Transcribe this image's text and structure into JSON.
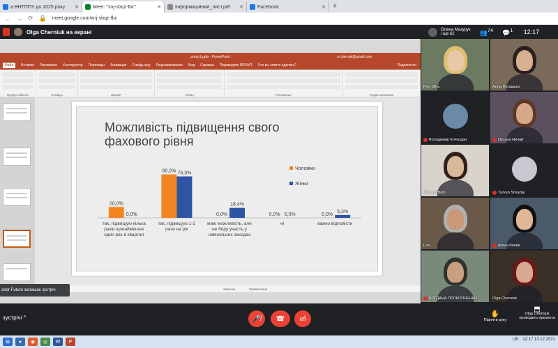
{
  "browser": {
    "tabs": [
      {
        "title": "а ВНТППУ до 2025 року",
        "color": "#1a73e8",
        "active": false
      },
      {
        "title": "Meet: \"xnj-sbqz-fbc\"",
        "color": "#00832d",
        "active": true
      },
      {
        "title": "Інформаційний_лист.pdf",
        "color": "#888888",
        "active": false
      },
      {
        "title": "Facebook",
        "color": "#1877f2",
        "active": false
      }
    ],
    "url": "meet.google.com/xnj-sbqz-fbc"
  },
  "meet": {
    "presenter_label": "Olga Cherniuk на екрані",
    "user_name": "Олена Мазурук",
    "user_sub": "і ще 62",
    "participant_count": "74",
    "chat_count": "1",
    "clock": "12:17",
    "toast": "andr Future залишає зустріч",
    "meeting_details": "зустрічі",
    "raise_hand": "Підняти руку",
    "presenting_line1": "Olga Cherniuk",
    "presenting_line2": "проводить презента"
  },
  "powerpoint": {
    "doc_title": "prezo1.pptx - PowerPoint",
    "account": "o.chernuk@gmail.com",
    "menu": [
      "Файл",
      "Вставка",
      "Рисование",
      "Конструктор",
      "Переходы",
      "Анимация",
      "Слайд-шоу",
      "Рецензирование",
      "Вид",
      "Справка",
      "Переводчик PROMT",
      "Что вы хотите сделать?"
    ],
    "share": "Поделиться",
    "ribbon_groups": [
      "Буфер обмена",
      "Слайды",
      "Шрифт",
      "Абзац",
      "Рисование",
      "Редактирование"
    ],
    "status_items": [
      "Заметки",
      "Примечания"
    ]
  },
  "chart_data": {
    "type": "bar",
    "title": "Можливість підвищення свого фахового рівня",
    "categories": [
      "так, підвищую кілька разів щонайменше один раз в квартал",
      "так, підвищую 1-2 рази на рік",
      "маю можливість, але не беру участь у навчальних заходах",
      "ні",
      "важко відповісти"
    ],
    "series": [
      {
        "name": "Чоловіки",
        "color": "#f4841f",
        "values": [
          20.0,
          80.0,
          0.0,
          0.0,
          0.0
        ],
        "labels": [
          "20,0%",
          "80,0%",
          "0,0%",
          "0,0%",
          "0,0%"
        ]
      },
      {
        "name": "Жінки",
        "color": "#2e55a4",
        "values": [
          0.0,
          76.3,
          18.4,
          0.0,
          5.3
        ],
        "labels": [
          "0,0%",
          "76,3%",
          "18,4%",
          "0,0%",
          "5,3%"
        ]
      }
    ],
    "ylim": [
      0,
      100
    ],
    "legend": "right"
  },
  "participants": [
    {
      "name": "Prof Olha",
      "muted": false,
      "kind": "person",
      "bg": "#6b7a60",
      "skin": "#e7c9a8",
      "hair": "#e0c070"
    },
    {
      "name": "Алла Погашько",
      "muted": false,
      "kind": "person",
      "bg": "#7a6a5a",
      "skin": "#d6b090",
      "hair": "#2a2020"
    },
    {
      "name": "Володимир Кочкодан",
      "muted": true,
      "kind": "avatar",
      "bg": "#202124",
      "av": "#6a8aa8"
    },
    {
      "name": "Оксана Ничай",
      "muted": true,
      "kind": "person",
      "bg": "#5a5060",
      "skin": "#d4a888",
      "hair": "#603828"
    },
    {
      "name": "Oksana Bahl",
      "muted": false,
      "kind": "person",
      "bg": "#d8d4cc",
      "skin": "#d8b898",
      "hair": "#302018"
    },
    {
      "name": "Turkan Sheydai",
      "muted": true,
      "kind": "avatar",
      "bg": "#202124",
      "av": "#c8c8d0"
    },
    {
      "name": "Lviv",
      "muted": false,
      "kind": "person",
      "bg": "#6a5848",
      "skin": "#c89878",
      "hair": "#b0b0b0"
    },
    {
      "name": "Ірина Кінова",
      "muted": true,
      "kind": "person",
      "bg": "#4a5a6a",
      "skin": "#e0b898",
      "hair": "#101010"
    },
    {
      "name": "БОГДАНА ПРОКОПЧЕНКО",
      "muted": true,
      "kind": "person",
      "bg": "#7a8a7a",
      "skin": "#c8a080",
      "hair": "#303030"
    },
    {
      "name": "Olga Cherniuk",
      "muted": false,
      "kind": "person",
      "bg": "#3a3028",
      "skin": "#d8a890",
      "hair": "#6a1818"
    }
  ],
  "taskbar": {
    "lang": "UK",
    "clock_time": "12:17",
    "clock_date": "13.12.2021"
  }
}
